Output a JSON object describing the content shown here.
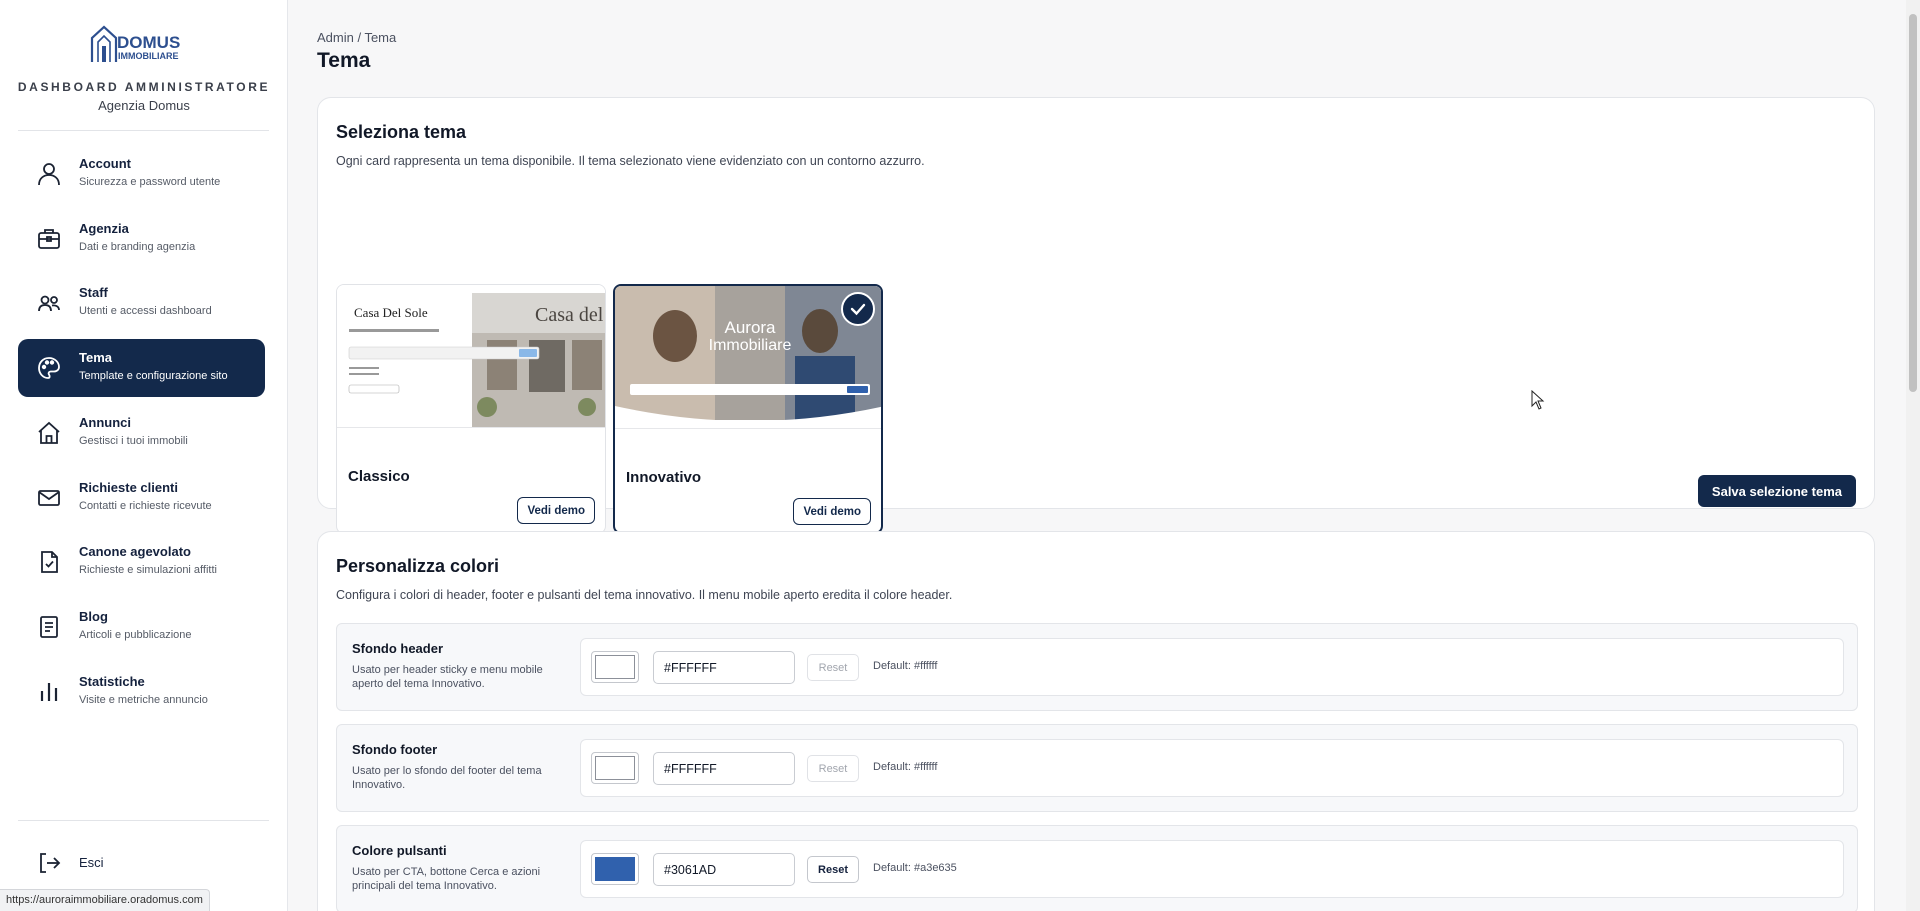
{
  "sidebar": {
    "logo_text": "DOMUS IMMOBILIARE",
    "dashboard_title": "DASHBOARD AMMINISTRATORE",
    "agency_name": "Agenzia Domus",
    "items": [
      {
        "label": "Account",
        "sub": "Sicurezza e password utente",
        "icon": "user-icon"
      },
      {
        "label": "Agenzia",
        "sub": "Dati e branding agenzia",
        "icon": "briefcase-icon"
      },
      {
        "label": "Staff",
        "sub": "Utenti e accessi dashboard",
        "icon": "users-icon"
      },
      {
        "label": "Tema",
        "sub": "Template e configurazione sito",
        "icon": "palette-icon",
        "active": true
      },
      {
        "label": "Annunci",
        "sub": "Gestisci i tuoi immobili",
        "icon": "home-icon"
      },
      {
        "label": "Richieste clienti",
        "sub": "Contatti e richieste ricevute",
        "icon": "mail-icon"
      },
      {
        "label": "Canone agevolato",
        "sub": "Richieste e simulazioni affitti",
        "icon": "document-icon"
      },
      {
        "label": "Blog",
        "sub": "Articoli e pubblicazione",
        "icon": "article-icon"
      },
      {
        "label": "Statistiche",
        "sub": "Visite e metriche annuncio",
        "icon": "bar-chart-icon"
      }
    ],
    "logout_label": "Esci",
    "status_url": "https://auroraimmobiliare.oradomus.com"
  },
  "header": {
    "breadcrumb": "Admin / Tema",
    "title": "Tema"
  },
  "theme_section": {
    "title": "Seleziona tema",
    "description": "Ogni card rappresenta un tema disponibile. Il tema selezionato viene evidenziato con un contorno azzurro.",
    "cards": [
      {
        "name": "Classico",
        "button": "Vedi demo",
        "selected": false,
        "preview_brand": "Casa Del Sole",
        "preview_brand_2": "Casa del S"
      },
      {
        "name": "Innovativo",
        "button": "Vedi demo",
        "selected": true,
        "preview_brand": "Aurora",
        "preview_brand_2": "Immobiliare"
      }
    ],
    "save_button": "Salva selezione tema"
  },
  "colors_section": {
    "title": "Personalizza colori",
    "description": "Configura i colori di header, footer e pulsanti del tema innovativo. Il menu mobile aperto eredita il colore header.",
    "rows": [
      {
        "label": "Sfondo header",
        "desc": "Usato per header sticky e menu mobile aperto del tema Innovativo.",
        "value": "#FFFFFF",
        "swatch": "#ffffff",
        "reset": "Reset",
        "reset_enabled": false,
        "default": "Default: #ffffff"
      },
      {
        "label": "Sfondo footer",
        "desc": "Usato per lo sfondo del footer del tema Innovativo.",
        "value": "#FFFFFF",
        "swatch": "#ffffff",
        "reset": "Reset",
        "reset_enabled": false,
        "default": "Default: #ffffff"
      },
      {
        "label": "Colore pulsanti",
        "desc": "Usato per CTA, bottone Cerca e azioni principali del tema Innovativo.",
        "value": "#3061AD",
        "swatch": "#3061ad",
        "reset": "Reset",
        "reset_enabled": true,
        "default": "Default: #a3e635"
      }
    ]
  },
  "colors": {
    "primary": "#13294b",
    "accent_swatch": "#3061ad"
  }
}
